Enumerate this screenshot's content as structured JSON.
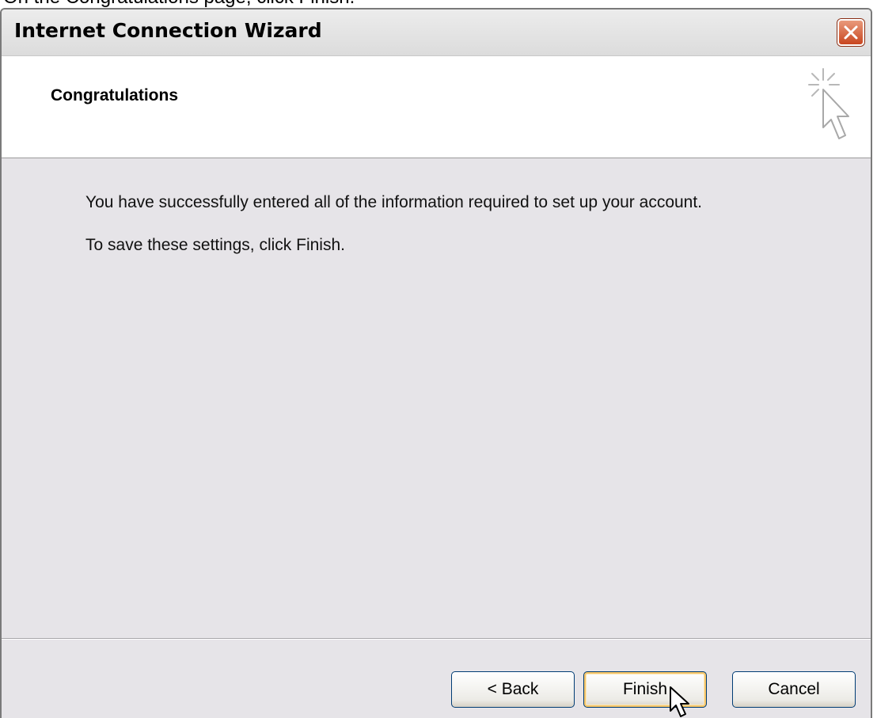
{
  "caption": {
    "text": "On the Congratulations page, click Finish."
  },
  "window": {
    "title": "Internet Connection Wizard"
  },
  "header": {
    "title": "Congratulations",
    "icon": "wizard-cursor-icon"
  },
  "body": {
    "line1": "You have successfully entered all of the information required to set up your account.",
    "line2": "To save these settings, click Finish."
  },
  "buttons": {
    "back": "< Back",
    "finish": "Finish",
    "cancel": "Cancel"
  },
  "colors": {
    "close_button": "#c8461f",
    "focus_ring": "#f5c56a",
    "button_border": "#003c74",
    "content_bg": "#e6e4e8"
  }
}
